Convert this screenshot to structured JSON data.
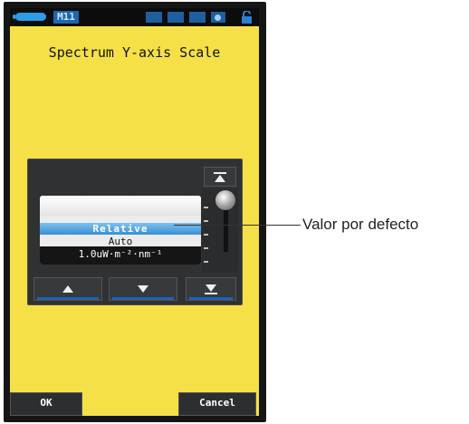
{
  "status_bar": {
    "memory_label": "M11",
    "icons": [
      "battery-icon",
      "memory-icon",
      "indicator-icon",
      "indicator-icon",
      "indicator-icon",
      "indicator-icon",
      "lock-icon"
    ]
  },
  "screen": {
    "title": "Spectrum Y-axis Scale"
  },
  "list": {
    "items": [
      {
        "label": ""
      },
      {
        "label": "Relative",
        "selected": true
      },
      {
        "label": "Auto"
      },
      {
        "label": "1.0uW·m⁻²·nm⁻¹"
      }
    ]
  },
  "buttons": {
    "scroll_top_icon": "double-up-arrow-icon",
    "up_icon": "up-arrow-icon",
    "down_icon": "down-arrow-icon",
    "scroll_bottom_icon": "double-down-arrow-icon"
  },
  "footer": {
    "ok_label": "OK",
    "cancel_label": "Cancel"
  },
  "annotation": {
    "text": "Valor por defecto"
  },
  "colors": {
    "screen_background": "#f5e048",
    "selection": "#3a8fd4",
    "accent_line": "#1d63b0"
  }
}
